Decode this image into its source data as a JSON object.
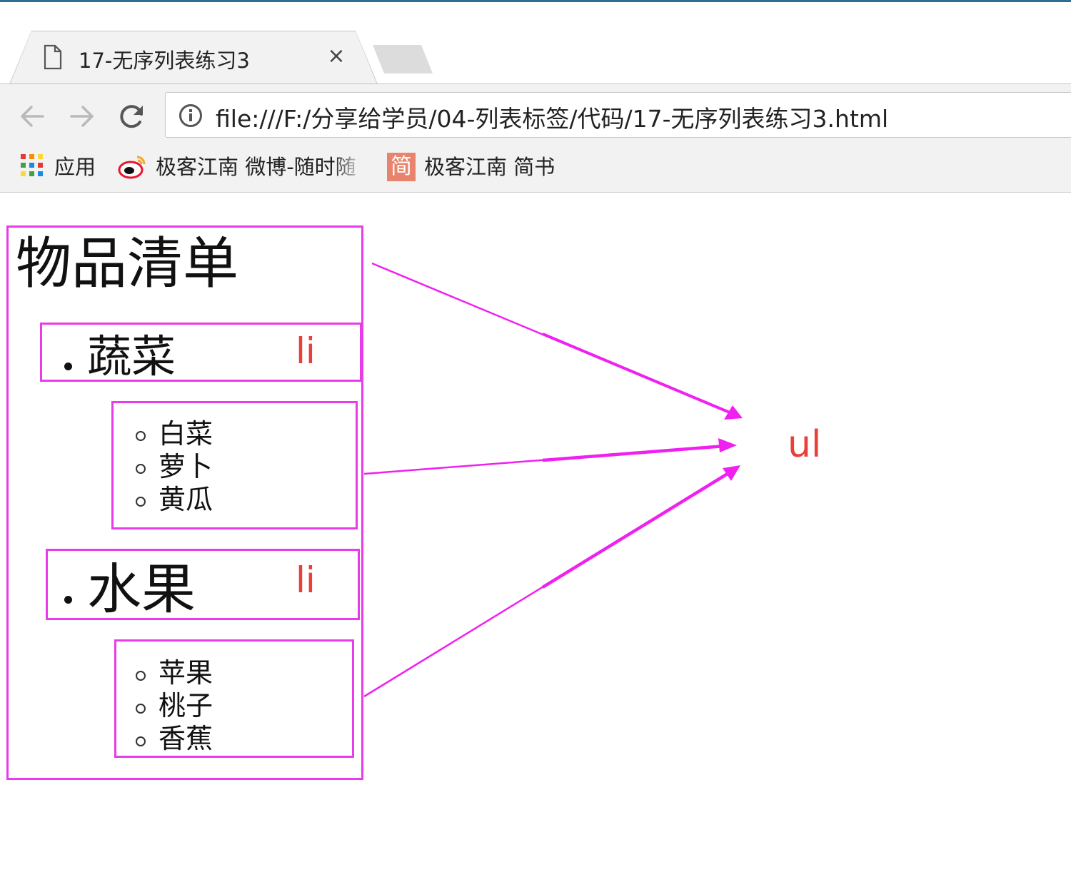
{
  "browser": {
    "tab_title": "17-无序列表练习3",
    "tab_close": "×",
    "url": "file:///F:/分享给学员/04-列表标签/代码/17-无序列表练习3.html",
    "bookmarks": [
      {
        "label": "应用",
        "icon": "apps-grid-icon"
      },
      {
        "label": "极客江南 微博-随时随",
        "icon": "weibo-icon"
      },
      {
        "label": "极客江南 简书",
        "icon": "jianshu-icon",
        "icon_text": "简"
      }
    ]
  },
  "page": {
    "heading": "物品清单",
    "lists": [
      {
        "label": "蔬菜",
        "items": [
          "白菜",
          "萝卜",
          "黄瓜"
        ]
      },
      {
        "label": "水果",
        "items": [
          "苹果",
          "桃子",
          "香蕉"
        ]
      }
    ],
    "annotations": {
      "li_label": "li",
      "ul_label": "ul"
    }
  },
  "colors": {
    "box_border": "#e83ce8",
    "annotation_text": "#e8403a",
    "arrow": "#f020f0"
  }
}
